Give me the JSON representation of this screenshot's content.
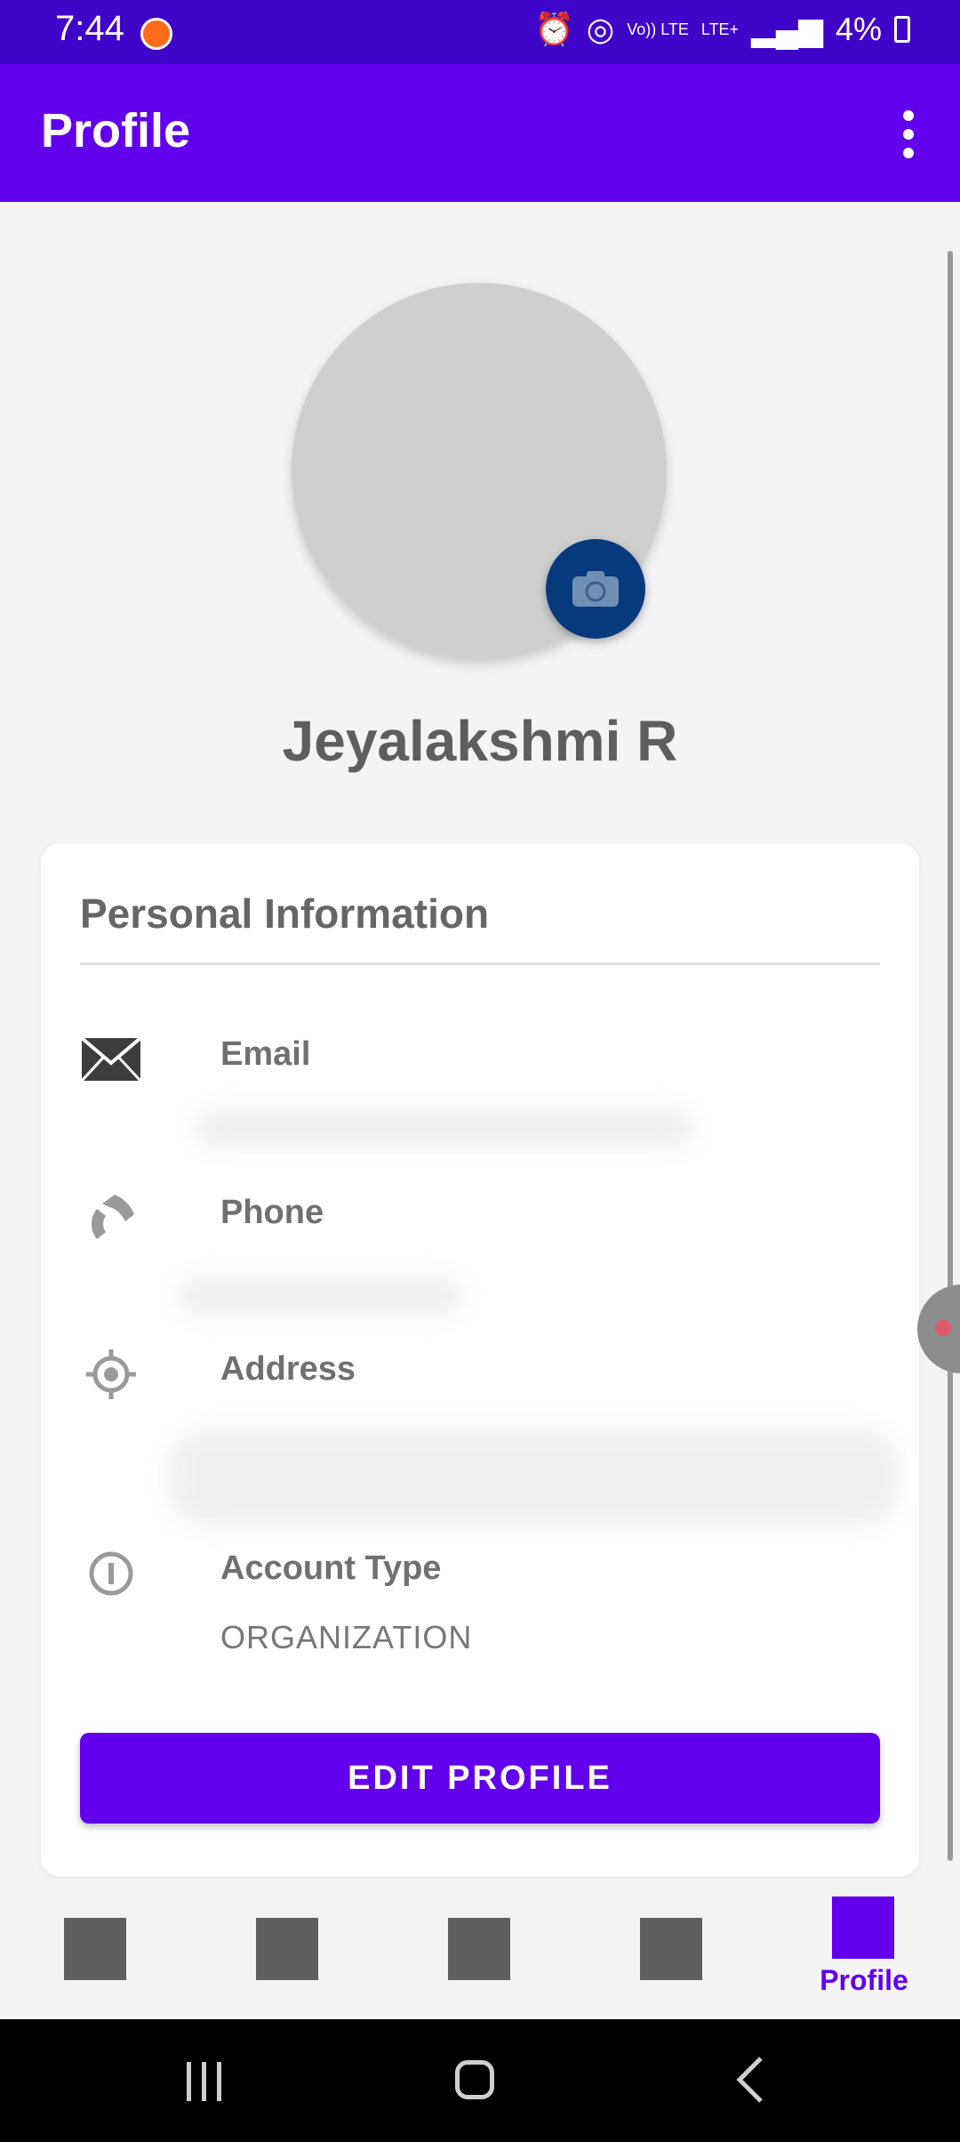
{
  "status_bar": {
    "time": "7:44",
    "battery": "4%",
    "volte": "Vo)) LTE",
    "lte": "LTE+"
  },
  "app_bar": {
    "title": "Profile"
  },
  "profile": {
    "name": "Jeyalakshmi R"
  },
  "personal_info": {
    "title": "Personal Information",
    "email_label": "Email",
    "phone_label": "Phone",
    "address_label": "Address",
    "account_type_label": "Account Type",
    "account_type_value": "ORGANIZATION"
  },
  "actions": {
    "edit_profile": "EDIT PROFILE"
  },
  "bottom_nav": {
    "active_label": "Profile"
  },
  "colors": {
    "primary": "#6200ee",
    "status_bar": "#3f06c9",
    "camera_button": "#063a7c"
  },
  "icons": {
    "email": "envelope-icon",
    "phone": "phone-icon",
    "address": "location-target-icon",
    "account_type": "info-icon",
    "camera": "camera-icon"
  }
}
